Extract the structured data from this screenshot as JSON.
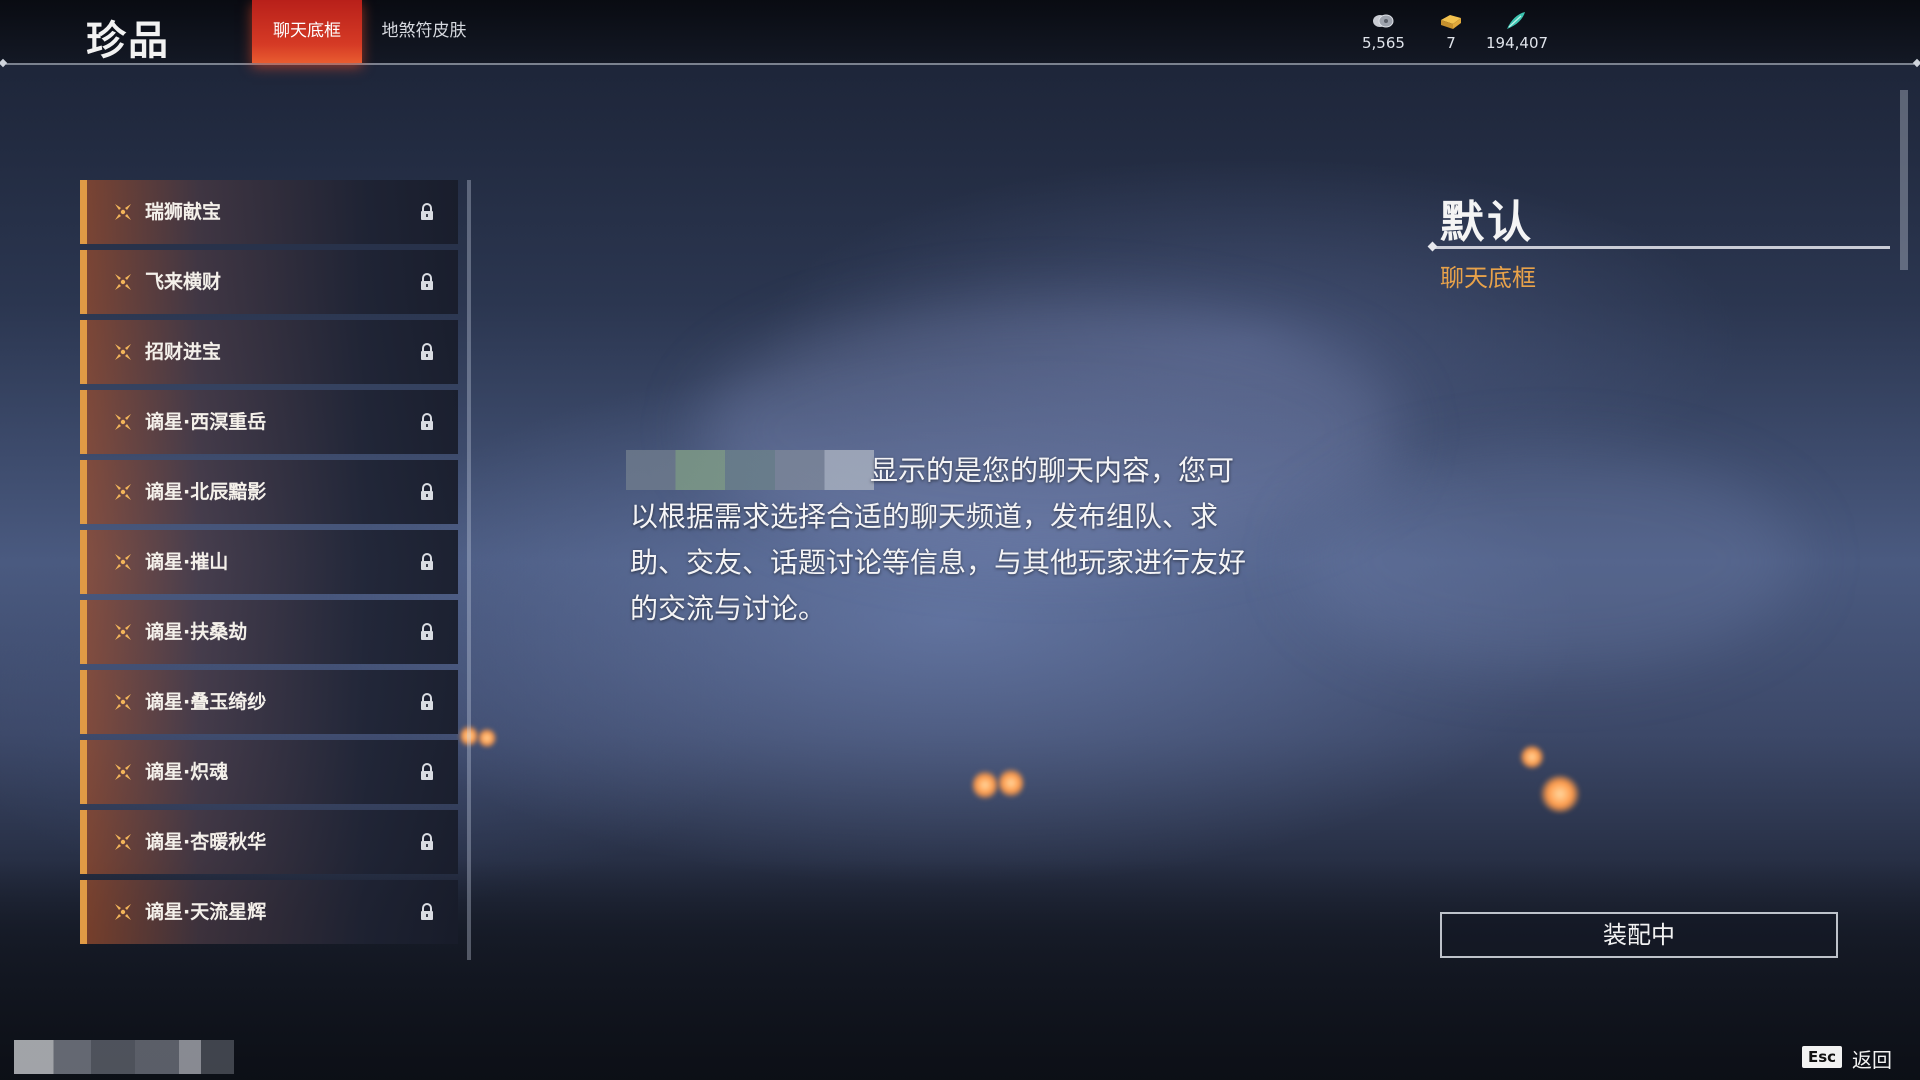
{
  "header": {
    "title": "珍品",
    "tabs": [
      {
        "label": "聊天底框",
        "active": true
      },
      {
        "label": "地煞符皮肤",
        "active": false
      }
    ],
    "currencies": [
      {
        "icon": "silver-coin-icon",
        "value": "5,565"
      },
      {
        "icon": "gold-ingot-icon",
        "value": "7"
      },
      {
        "icon": "jade-feather-icon",
        "value": "194,407"
      }
    ]
  },
  "list": {
    "items": [
      {
        "name": "瑞狮献宝",
        "locked": true
      },
      {
        "name": "飞来横财",
        "locked": true
      },
      {
        "name": "招财进宝",
        "locked": true
      },
      {
        "name": "谪星·西溟重岳",
        "locked": true
      },
      {
        "name": "谪星·北辰黯影",
        "locked": true
      },
      {
        "name": "谪星·摧山",
        "locked": true
      },
      {
        "name": "谪星·扶桑劫",
        "locked": true
      },
      {
        "name": "谪星·叠玉绮纱",
        "locked": true
      },
      {
        "name": "谪星·炽魂",
        "locked": true
      },
      {
        "name": "谪星·杏暖秋华",
        "locked": true
      },
      {
        "name": "谪星·天流星辉",
        "locked": true
      }
    ]
  },
  "preview": {
    "text_line1": "显示的是您的聊天内容，您可",
    "text_rest": "以根据需求选择合适的聊天频道，发布组队、求助、交友、话题讨论等信息，与其他玩家进行友好的交流与讨论。"
  },
  "detail": {
    "title": "默认",
    "category": "聊天底框",
    "equip_button": "装配中"
  },
  "footer": {
    "esc_key": "Esc",
    "esc_label": "返回"
  },
  "colors": {
    "accent_orange": "#e09a45",
    "tab_red": "#d53a25"
  }
}
